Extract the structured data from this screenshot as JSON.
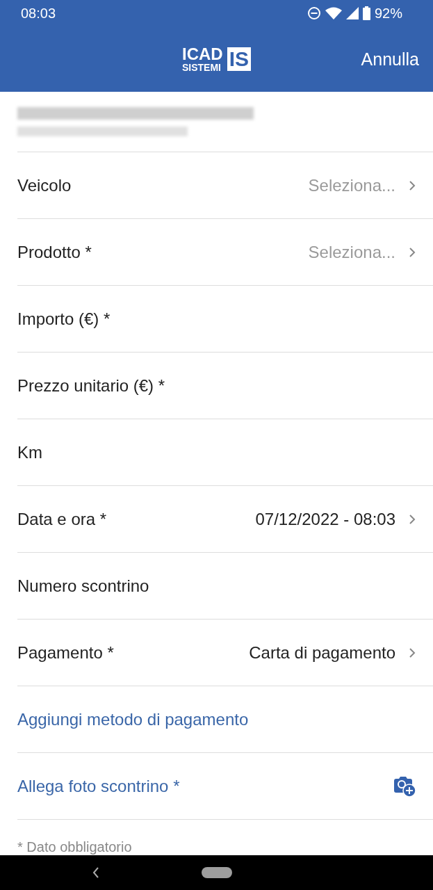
{
  "status_bar": {
    "time": "08:03",
    "battery": "92%"
  },
  "header": {
    "logo": {
      "line_1": "ICAD",
      "line_2": "SISTEMI",
      "mark": "IS"
    },
    "cancel": "Annulla"
  },
  "form": [
    {
      "kind": "select",
      "label": "Veicolo",
      "placeholder": "Seleziona..."
    },
    {
      "kind": "select",
      "label": "Prodotto *",
      "placeholder": "Seleziona..."
    },
    {
      "kind": "input",
      "label": "Importo (€) *"
    },
    {
      "kind": "input",
      "label": "Prezzo unitario (€) *"
    },
    {
      "kind": "input",
      "label": "Km"
    },
    {
      "kind": "select",
      "label": "Data e ora *",
      "value": "07/12/2022 - 08:03"
    },
    {
      "kind": "input",
      "label": "Numero scontrino"
    },
    {
      "kind": "select",
      "label": "Pagamento *",
      "value": "Carta di pagamento"
    },
    {
      "kind": "link",
      "label": "Aggiungi metodo di pagamento"
    },
    {
      "kind": "attach",
      "label": "Allega foto scontrino *"
    }
  ],
  "footnote": "* Dato obbligatorio"
}
